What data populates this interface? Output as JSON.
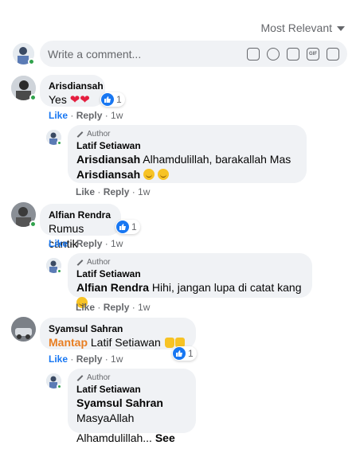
{
  "sort": {
    "label": "Most Relevant"
  },
  "composer": {
    "placeholder": "Write a comment..."
  },
  "comments": [
    {
      "name": "Arisdiansah",
      "text": "Yes",
      "hearts": "❤❤",
      "reactions": "1",
      "like": "Like",
      "reply": "Reply",
      "time": "1w",
      "replies": [
        {
          "badge": "Author",
          "name": "Latif Setiawan",
          "mention": "Arisdiansah",
          "text_before": "Alhamdulillah, barakallah Mas",
          "like": "Like",
          "reply": "Reply",
          "time": "1w"
        }
      ]
    },
    {
      "name": "Alfian Rendra",
      "text": "Rumus cantik",
      "reactions": "1",
      "like": "Like",
      "reply": "Reply",
      "time": "1w",
      "replies": [
        {
          "badge": "Author",
          "name": "Latif Setiawan",
          "mention": "Alfian Rendra",
          "text": "Hihi, jangan lupa di catat kang",
          "like": "Like",
          "reply": "Reply",
          "time": "1w"
        }
      ]
    },
    {
      "name": "Syamsul Sahran",
      "highlight": "Mantap",
      "mention": "Latif Setiawan",
      "reactions": "1",
      "like": "Like",
      "reply": "Reply",
      "time": "1w",
      "replies": [
        {
          "badge": "Author",
          "name": "Latif Setiawan",
          "mention": "Syamsul Sahran",
          "text": "MasyaAllah",
          "text2": "Alhamdulillah...",
          "see_more": "See More"
        }
      ]
    }
  ],
  "colors": {
    "accent": "#1877f2",
    "highlight": "#e87e22",
    "online": "#31a24c"
  }
}
